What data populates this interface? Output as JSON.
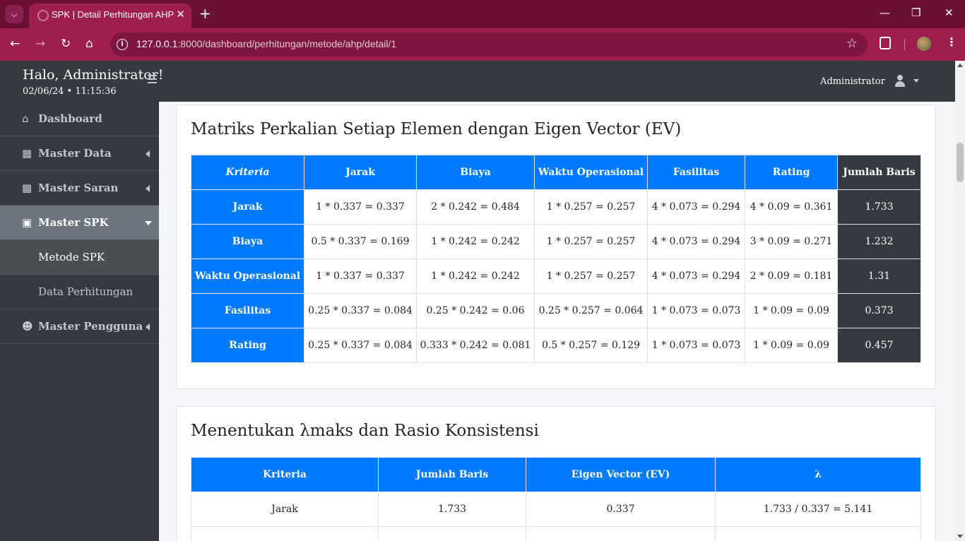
{
  "browser": {
    "tab_title": "SPK | Detail Perhitungan AHP",
    "url_host": "127.0.0.1",
    "url_path": ":8000/dashboard/perhitungan/metode/ahp/detail/1"
  },
  "header": {
    "greeting": "Halo, Administrator!",
    "datetime": "02/06/24 • 11:15:36",
    "user_name": "Administrator"
  },
  "sidebar": {
    "items": [
      {
        "label": "Dashboard",
        "icon": "home-icon"
      },
      {
        "label": "Master Data",
        "icon": "cubes-icon"
      },
      {
        "label": "Master Saran",
        "icon": "comment-icon"
      },
      {
        "label": "Master SPK",
        "icon": "sitemap-icon"
      },
      {
        "label": "Master Pengguna",
        "icon": "users-cog-icon"
      }
    ],
    "sub_items": [
      {
        "label": "Metode SPK"
      },
      {
        "label": "Data Perhitungan"
      }
    ]
  },
  "matrix_card": {
    "title": "Matriks Perkalian Setiap Elemen dengan Eigen Vector (EV)",
    "headers": [
      "Kriteria",
      "Jarak",
      "Biaya",
      "Waktu Operasional",
      "Fasilitas",
      "Rating",
      "Jumlah Baris"
    ],
    "rows": [
      {
        "name": "Jarak",
        "cells": [
          "1 * 0.337 = 0.337",
          "2 * 0.242 = 0.484",
          "1 * 0.257 = 0.257",
          "4 * 0.073 = 0.294",
          "4 * 0.09 = 0.361"
        ],
        "sum": "1.733"
      },
      {
        "name": "Biaya",
        "cells": [
          "0.5 * 0.337 = 0.169",
          "1 * 0.242 = 0.242",
          "1 * 0.257 = 0.257",
          "4 * 0.073 = 0.294",
          "3 * 0.09 = 0.271"
        ],
        "sum": "1.232"
      },
      {
        "name": "Waktu Operasional",
        "cells": [
          "1 * 0.337 = 0.337",
          "1 * 0.242 = 0.242",
          "1 * 0.257 = 0.257",
          "4 * 0.073 = 0.294",
          "2 * 0.09 = 0.181"
        ],
        "sum": "1.31"
      },
      {
        "name": "Fasilitas",
        "cells": [
          "0.25 * 0.337 = 0.084",
          "0.25 * 0.242 = 0.06",
          "0.25 * 0.257 = 0.064",
          "1 * 0.073 = 0.073",
          "1 * 0.09 = 0.09"
        ],
        "sum": "0.373"
      },
      {
        "name": "Rating",
        "cells": [
          "0.25 * 0.337 = 0.084",
          "0.333 * 0.242 = 0.081",
          "0.5 * 0.257 = 0.129",
          "1 * 0.073 = 0.073",
          "1 * 0.09 = 0.09"
        ],
        "sum": "0.457"
      }
    ]
  },
  "lambda_card": {
    "title": "Menentukan λmaks dan Rasio Konsistensi",
    "headers": [
      "Kriteria",
      "Jumlah Baris",
      "Eigen Vector (EV)",
      "λ"
    ],
    "rows": [
      {
        "name": "Jarak",
        "sum": "1.733",
        "ev": "0.337",
        "lambda": "1.733 / 0.337 = 5.141"
      }
    ]
  },
  "colors": {
    "primary": "#007bff",
    "dark": "#343a40",
    "browser": "#9e1e4f"
  }
}
